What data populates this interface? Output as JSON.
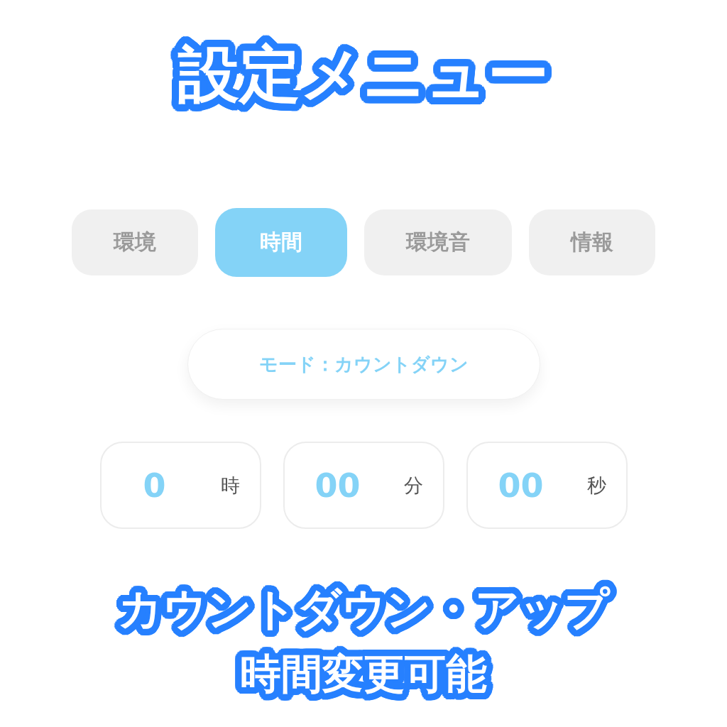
{
  "headline": {
    "title": "設定メニュー"
  },
  "tabs": [
    {
      "label": "環境",
      "selected": false
    },
    {
      "label": "時間",
      "selected": true
    },
    {
      "label": "環境音",
      "selected": false
    },
    {
      "label": "情報",
      "selected": false
    }
  ],
  "mode_button": {
    "label": "モード：カウントダウン"
  },
  "time_fields": [
    {
      "value": "0",
      "unit": "時"
    },
    {
      "value": "00",
      "unit": "分"
    },
    {
      "value": "00",
      "unit": "秒"
    }
  ],
  "caption": {
    "line_1": "カウントダウン・アップ",
    "line_2": "時間変更可能"
  }
}
